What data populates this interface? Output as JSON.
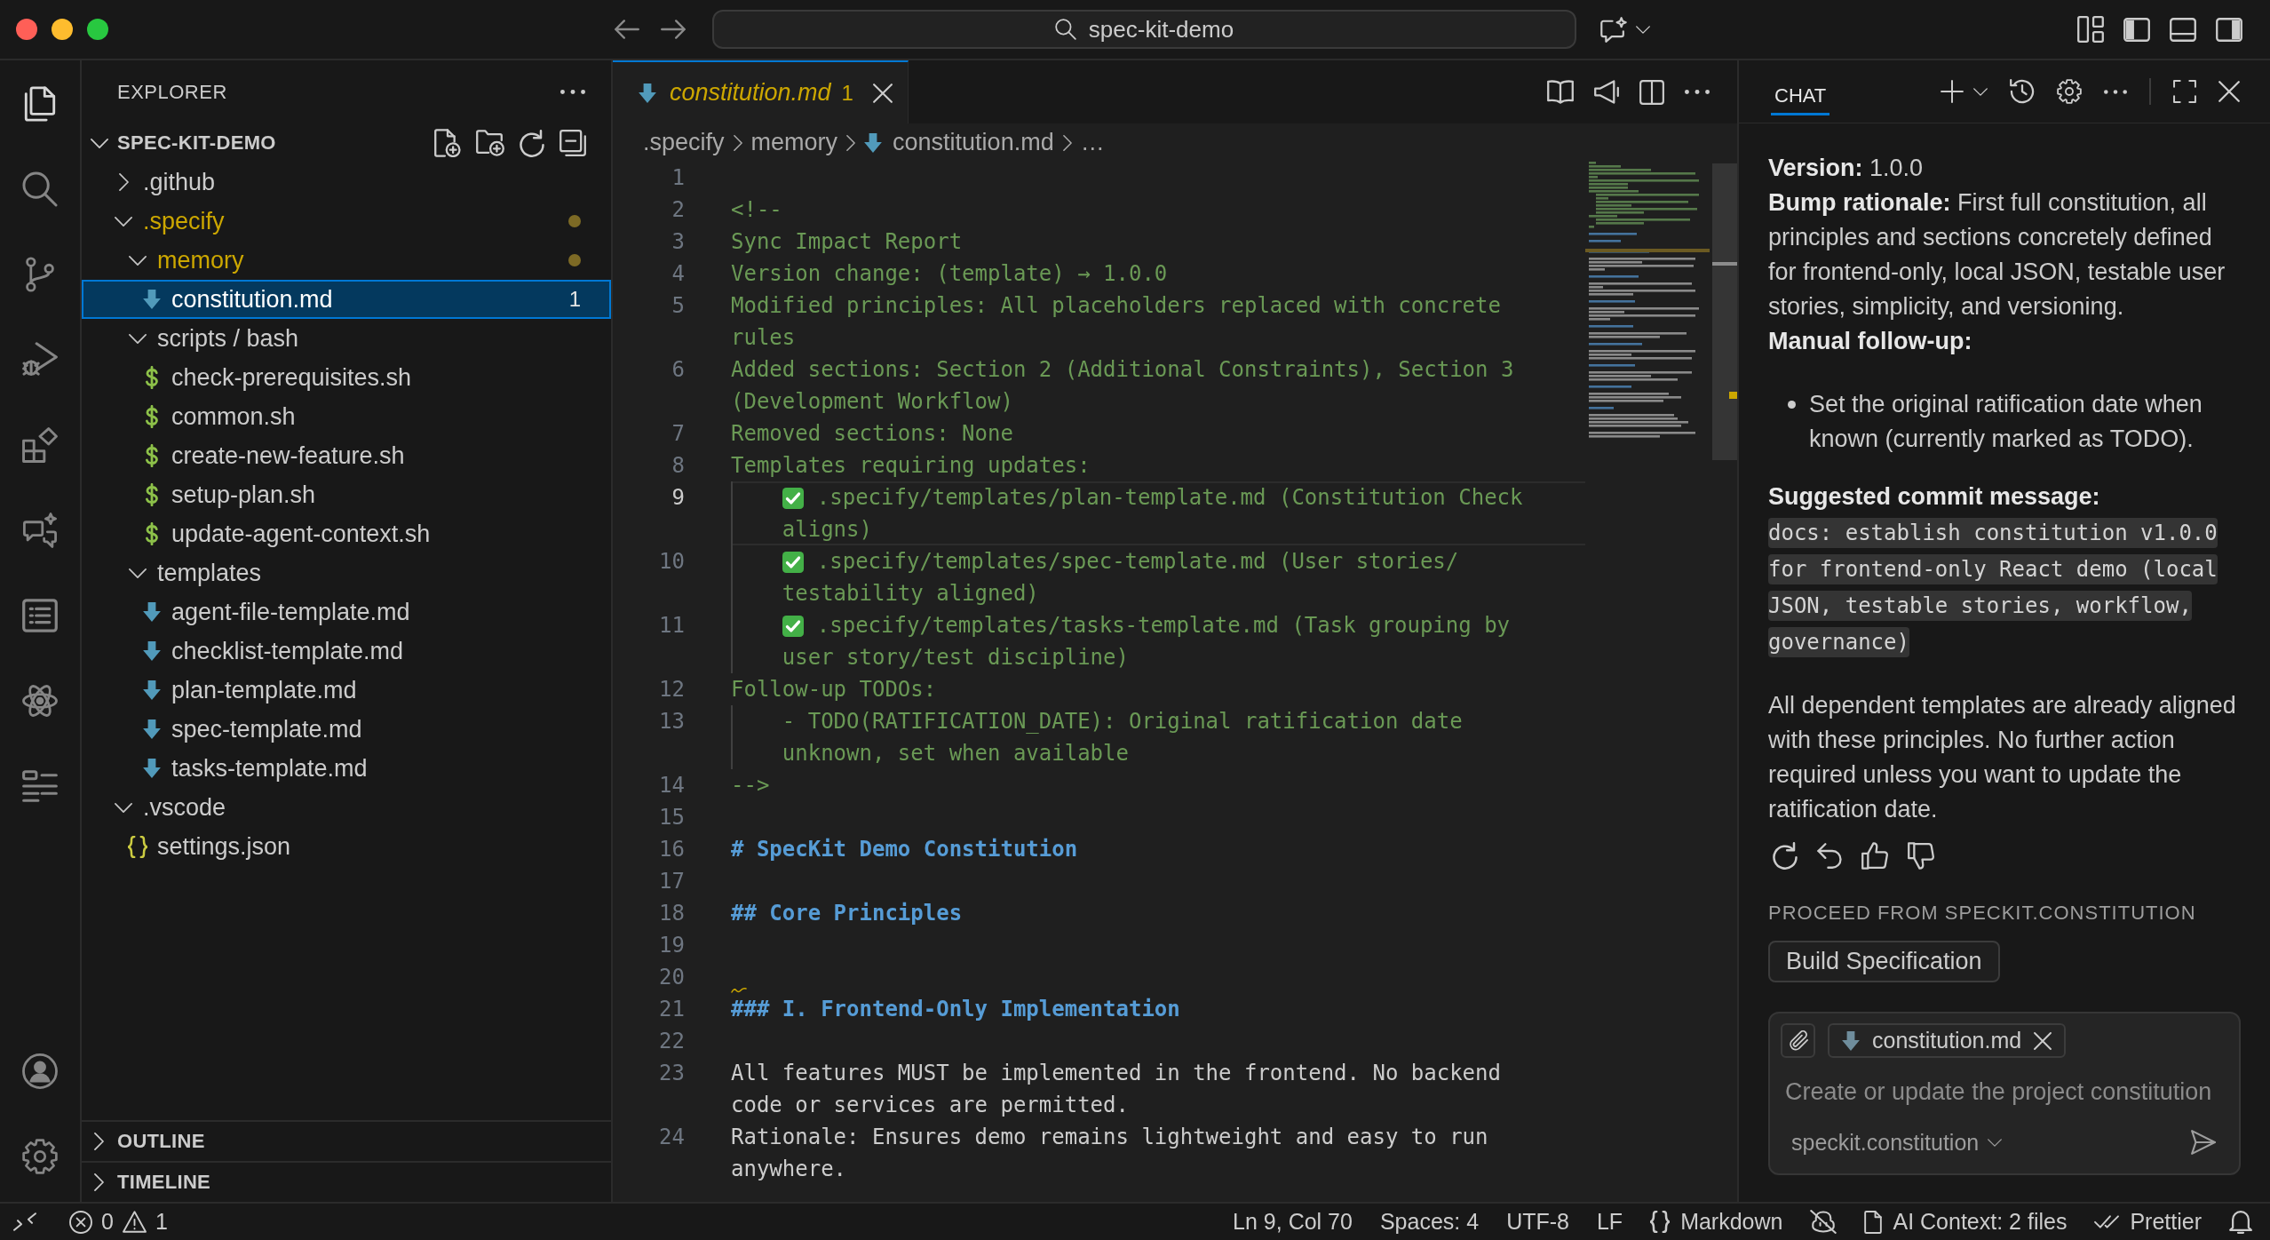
{
  "window": {
    "title": "spec-kit-demo"
  },
  "activity_bar": {
    "items": [
      {
        "kind": "explorer",
        "selected": true
      },
      {
        "kind": "search",
        "selected": false
      },
      {
        "kind": "source-control",
        "selected": false
      },
      {
        "kind": "run-debug",
        "selected": false
      },
      {
        "kind": "extensions",
        "selected": false
      },
      {
        "kind": "chat",
        "selected": false
      },
      {
        "kind": "list",
        "selected": false
      },
      {
        "kind": "atom",
        "selected": false
      },
      {
        "kind": "outline",
        "selected": false
      }
    ],
    "bottom": [
      {
        "kind": "account"
      },
      {
        "kind": "settings"
      }
    ]
  },
  "sidebar": {
    "title": "EXPLORER",
    "root": {
      "label": "SPEC-KIT-DEMO",
      "expanded": true,
      "children": [
        {
          "label": ".github",
          "kind": "folder",
          "expanded": false,
          "selected": false,
          "problem": false
        },
        {
          "label": ".specify",
          "kind": "folder",
          "expanded": true,
          "selected": false,
          "problem": true,
          "children": [
            {
              "label": "memory",
              "kind": "folder",
              "expanded": true,
              "selected": false,
              "problem": true,
              "children": [
                {
                  "label": "constitution.md",
                  "kind": "markdown",
                  "selected": true,
                  "badge": "1"
                }
              ]
            },
            {
              "label": "scripts / bash",
              "kind": "folder",
              "expanded": true,
              "selected": false,
              "problem": false,
              "children": [
                {
                  "label": "check-prerequisites.sh",
                  "kind": "shell",
                  "selected": false
                },
                {
                  "label": "common.sh",
                  "kind": "shell",
                  "selected": false
                },
                {
                  "label": "create-new-feature.sh",
                  "kind": "shell",
                  "selected": false
                },
                {
                  "label": "setup-plan.sh",
                  "kind": "shell",
                  "selected": false
                },
                {
                  "label": "update-agent-context.sh",
                  "kind": "shell",
                  "selected": false
                }
              ]
            },
            {
              "label": "templates",
              "kind": "folder",
              "expanded": true,
              "selected": false,
              "problem": false,
              "children": [
                {
                  "label": "agent-file-template.md",
                  "kind": "markdown",
                  "selected": false
                },
                {
                  "label": "checklist-template.md",
                  "kind": "markdown",
                  "selected": false
                },
                {
                  "label": "plan-template.md",
                  "kind": "markdown",
                  "selected": false
                },
                {
                  "label": "spec-template.md",
                  "kind": "markdown",
                  "selected": false
                },
                {
                  "label": "tasks-template.md",
                  "kind": "markdown",
                  "selected": false
                }
              ]
            }
          ]
        },
        {
          "label": ".vscode",
          "kind": "folder",
          "expanded": true,
          "selected": false,
          "problem": false,
          "children": [
            {
              "label": "settings.json",
              "kind": "json",
              "selected": false
            }
          ]
        }
      ]
    },
    "sections": [
      {
        "label": "OUTLINE",
        "expanded": false
      },
      {
        "label": "TIMELINE",
        "expanded": false
      }
    ]
  },
  "editor": {
    "tabs": [
      {
        "label": "constitution.md",
        "badge": "1",
        "selected": true,
        "preview": true,
        "problem": true
      }
    ],
    "breadcrumbs": [
      {
        "label": ".specify",
        "kind": "folder"
      },
      {
        "label": "memory",
        "kind": "folder"
      },
      {
        "label": "constitution.md",
        "kind": "markdown"
      },
      {
        "label": "…",
        "kind": "more"
      }
    ],
    "lines": [
      {
        "number": "1",
        "kind": "blank",
        "current": false,
        "warning": false
      },
      {
        "number": "2",
        "kind": "comment",
        "rows": [
          "<!--"
        ],
        "current": false,
        "warning": false
      },
      {
        "number": "3",
        "kind": "comment",
        "rows": [
          "Sync Impact Report"
        ],
        "current": false,
        "warning": false
      },
      {
        "number": "4",
        "kind": "comment",
        "rows": [
          "Version change: (template) → 1.0.0"
        ],
        "current": false,
        "warning": false
      },
      {
        "number": "5",
        "kind": "comment",
        "rows": [
          "Modified principles: All placeholders replaced with concrete",
          "rules"
        ],
        "current": false,
        "warning": false
      },
      {
        "number": "6",
        "kind": "comment",
        "rows": [
          "Added sections: Section 2 (Additional Constraints), Section 3",
          "(Development Workflow)"
        ],
        "current": false,
        "warning": false
      },
      {
        "number": "7",
        "kind": "comment",
        "rows": [
          "Removed sections: None"
        ],
        "current": false,
        "warning": false
      },
      {
        "number": "8",
        "kind": "comment",
        "rows": [
          "Templates requiring updates:"
        ],
        "current": false,
        "warning": false
      },
      {
        "number": "9",
        "kind": "check",
        "rows": [
          ".specify/templates/plan-template.md (Constitution Check",
          "aligns)"
        ],
        "current": true,
        "warning": false
      },
      {
        "number": "10",
        "kind": "check",
        "rows": [
          ".specify/templates/spec-template.md (User stories/",
          "testability aligned)"
        ],
        "current": false,
        "warning": false
      },
      {
        "number": "11",
        "kind": "check",
        "rows": [
          ".specify/templates/tasks-template.md (Task grouping by",
          "user story/test discipline)"
        ],
        "current": false,
        "warning": false
      },
      {
        "number": "12",
        "kind": "comment",
        "rows": [
          "Follow-up TODOs:"
        ],
        "current": false,
        "warning": false
      },
      {
        "number": "13",
        "kind": "indent",
        "rows": [
          "- TODO(RATIFICATION_DATE): Original ratification date",
          "unknown, set when available"
        ],
        "current": false,
        "warning": false
      },
      {
        "number": "14",
        "kind": "comment",
        "rows": [
          "-->"
        ],
        "current": false,
        "warning": false
      },
      {
        "number": "15",
        "kind": "blank",
        "current": false,
        "warning": false
      },
      {
        "number": "16",
        "kind": "heading",
        "rows": [
          "# SpecKit Demo Constitution"
        ],
        "current": false,
        "warning": false
      },
      {
        "number": "17",
        "kind": "blank",
        "current": false,
        "warning": false
      },
      {
        "number": "18",
        "kind": "heading",
        "rows": [
          "## Core Principles"
        ],
        "current": false,
        "warning": false
      },
      {
        "number": "19",
        "kind": "blank",
        "current": false,
        "warning": false
      },
      {
        "number": "20",
        "kind": "blank",
        "current": false,
        "warning": true
      },
      {
        "number": "21",
        "kind": "heading",
        "rows": [
          "### I. Frontend-Only Implementation"
        ],
        "current": false,
        "warning": false
      },
      {
        "number": "22",
        "kind": "blank",
        "current": false,
        "warning": false
      },
      {
        "number": "23",
        "kind": "text",
        "rows": [
          "All features MUST be implemented in the frontend. No backend",
          "code or services are permitted."
        ],
        "current": false,
        "warning": false
      },
      {
        "number": "24",
        "kind": "text",
        "rows": [
          "Rationale: Ensures demo remains lightweight and easy to run",
          "anywhere."
        ],
        "current": false,
        "warning": false
      }
    ]
  },
  "chat": {
    "tabs": [
      {
        "label": "CHAT",
        "selected": true
      }
    ],
    "response": [
      {
        "kind": "field",
        "text": "**Version:** 1.0.0"
      },
      {
        "kind": "field",
        "text": "**Bump rationale:** First full constitution, all principles and sections concretely defined for frontend-only, local JSON, testable user stories, simplicity, and versioning."
      },
      {
        "kind": "heading",
        "text": "Manual follow-up:"
      },
      {
        "kind": "bullet",
        "text": "Set the original ratification date when known (currently marked as TODO)."
      },
      {
        "kind": "heading",
        "text": "Suggested commit message:"
      },
      {
        "kind": "code",
        "text": "docs: establish constitution v1.0.0 for frontend-only React demo (local JSON, testable stories, workflow, governance)"
      },
      {
        "kind": "paragraph",
        "text": "All dependent templates are already aligned with these principles. No further action required unless you want to update the ratification date."
      }
    ],
    "proceed": {
      "label": "PROCEED FROM SPECKIT.CONSTITUTION",
      "buttons": [
        "Build Specification"
      ]
    },
    "input": {
      "attachments": [
        {
          "label": "constitution.md",
          "kind": "markdown"
        }
      ],
      "placeholder": "Create or update the project constitution",
      "mode": "speckit.constitution"
    }
  },
  "status_bar": {
    "errors": "0",
    "warnings": "1",
    "items": [
      {
        "kind": "text",
        "label": "Ln 9, Col 70"
      },
      {
        "kind": "text",
        "label": "Spaces: 4"
      },
      {
        "kind": "text",
        "label": "UTF-8"
      },
      {
        "kind": "text",
        "label": "LF"
      },
      {
        "kind": "language",
        "label": "Markdown"
      },
      {
        "kind": "copilot"
      },
      {
        "kind": "context",
        "label": "AI Context: 2 files"
      },
      {
        "kind": "formatter",
        "label": "Prettier"
      },
      {
        "kind": "notifications"
      }
    ]
  }
}
